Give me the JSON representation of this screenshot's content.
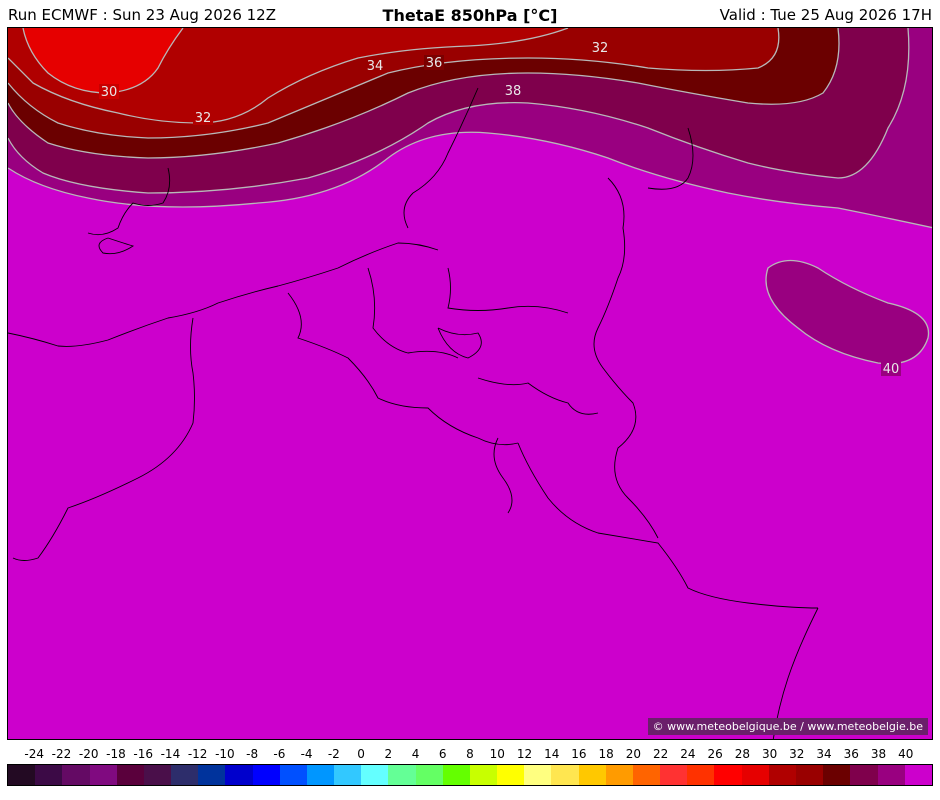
{
  "header": {
    "run": "Run ECMWF : Sun 23 Aug 2026 12Z",
    "title": "ThetaE 850hPa [°C]",
    "valid": "Valid : Tue 25 Aug 2026 17H"
  },
  "copyright": "© www.meteobelgique.be / www.meteobelgie.be",
  "contour_labels": [
    "30",
    "32",
    "34",
    "36",
    "38",
    "32",
    "40"
  ],
  "colors": {
    "background_fill": "#cc00cc",
    "fill_30_32": "#e60000",
    "fill_32_34": "#b00000",
    "fill_34_36": "#990000",
    "fill_36_38": "#6b0000",
    "fill_38_40": "#7f004c",
    "fill_40_plus": "#990080"
  },
  "color_scale": {
    "labels": [
      "-24",
      "-22",
      "-20",
      "-18",
      "-16",
      "-14",
      "-12",
      "-10",
      "-8",
      "-6",
      "-4",
      "-2",
      "0",
      "2",
      "4",
      "6",
      "8",
      "10",
      "12",
      "14",
      "16",
      "18",
      "20",
      "22",
      "24",
      "26",
      "28",
      "30",
      "32",
      "34",
      "36",
      "38",
      "40"
    ],
    "colors": [
      "#230a23",
      "#3c0a46",
      "#640a64",
      "#800a80",
      "#5a003c",
      "#4a0f4a",
      "#2d2d6b",
      "#00339c",
      "#0000cc",
      "#0000ff",
      "#0050ff",
      "#0096ff",
      "#32c8ff",
      "#64ffff",
      "#64ff96",
      "#64ff64",
      "#64ff00",
      "#c8ff00",
      "#ffff00",
      "#ffff80",
      "#ffe650",
      "#ffc800",
      "#ff9b00",
      "#ff6400",
      "#ff3232",
      "#ff3200",
      "#ff0000",
      "#e60000",
      "#b00000",
      "#990000",
      "#6b0000",
      "#7f004c",
      "#990080",
      "#cc00cc"
    ]
  }
}
